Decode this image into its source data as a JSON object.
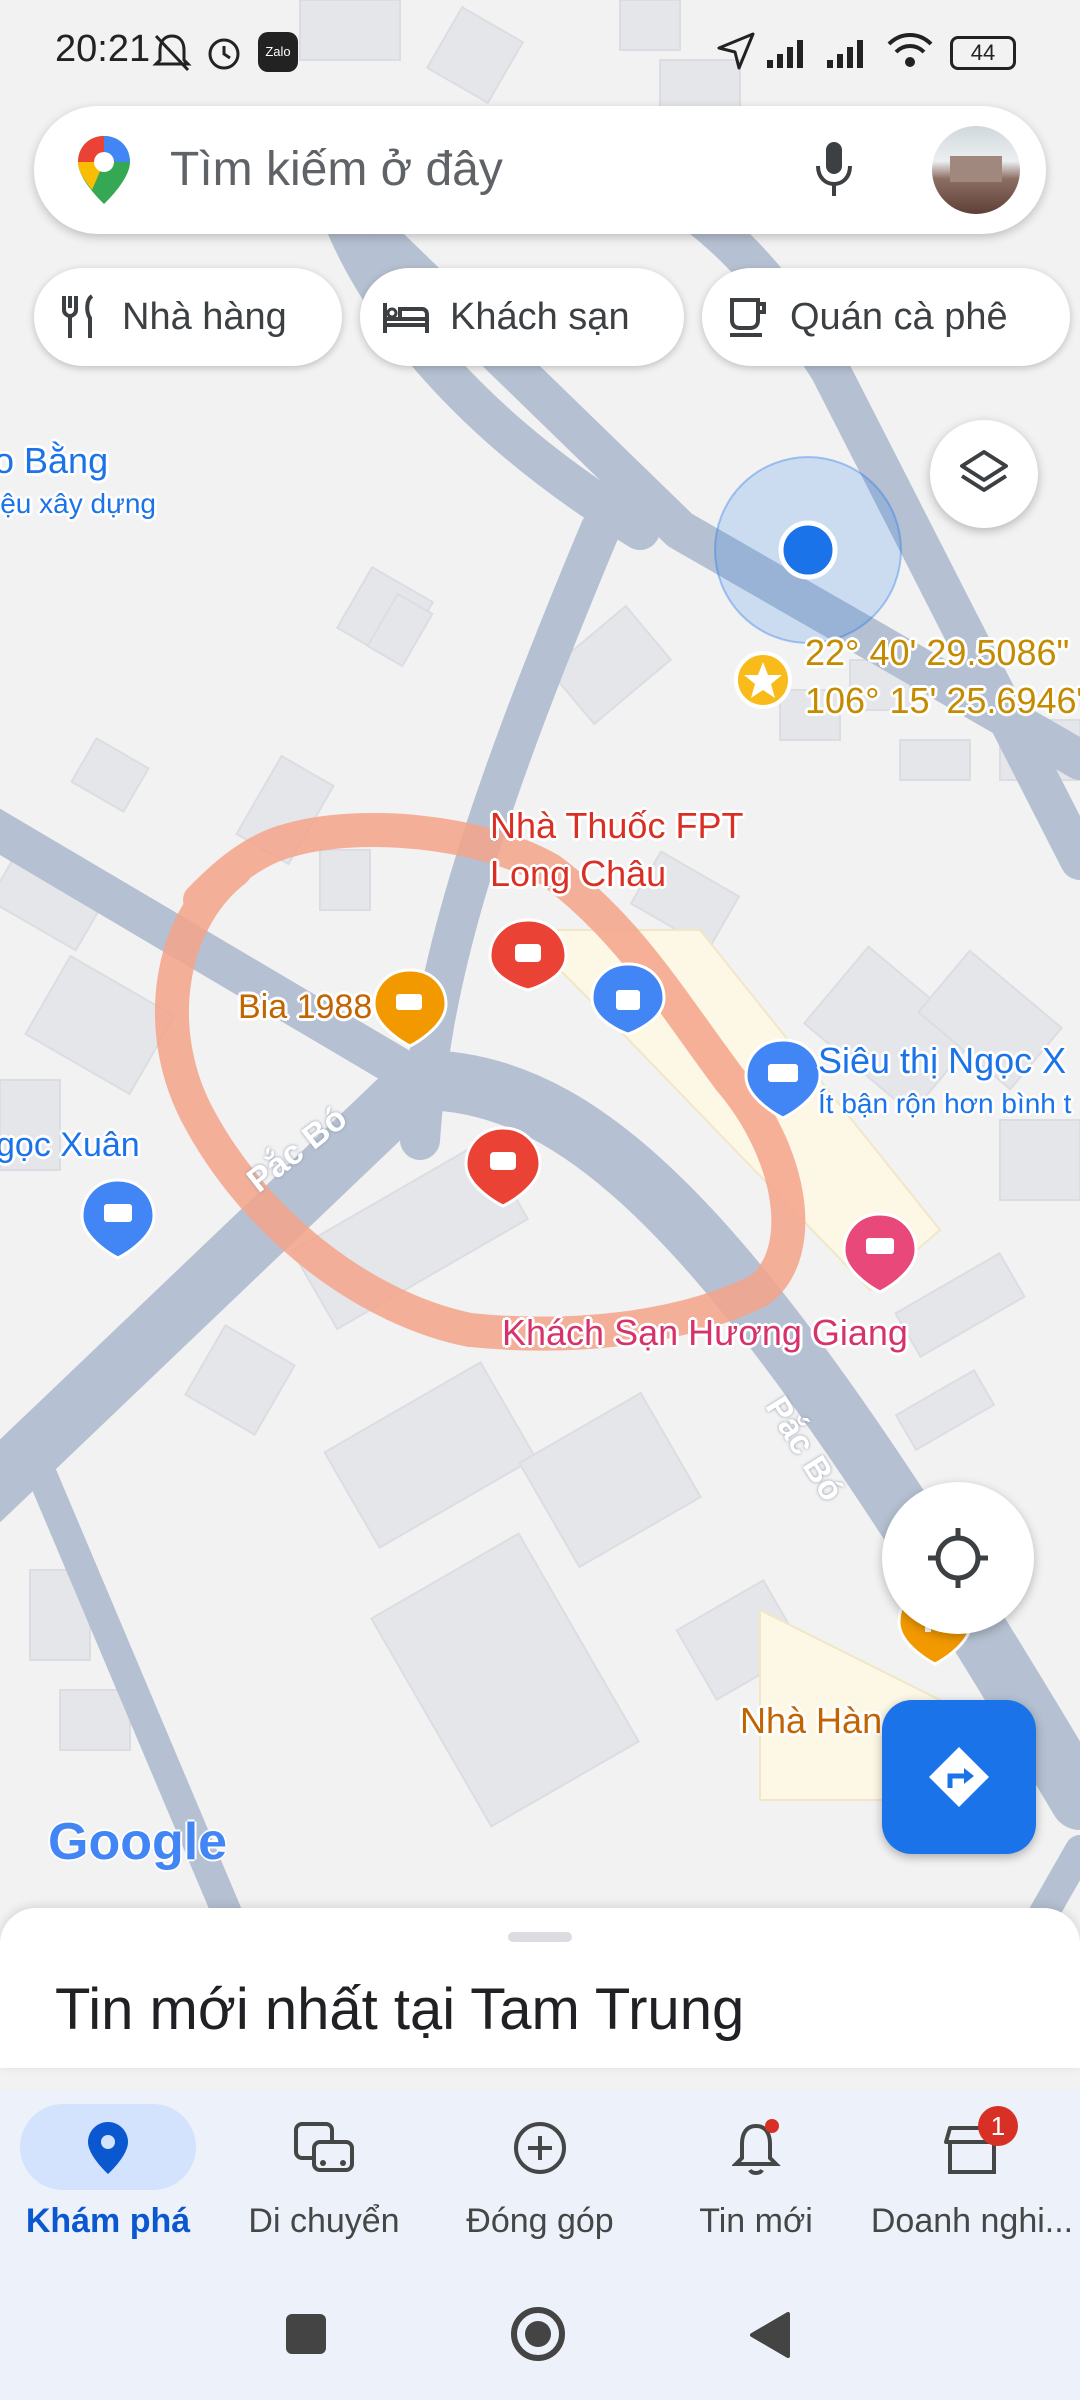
{
  "status_bar": {
    "time": "20:21",
    "left_icons": [
      "bell-off-icon",
      "alarm-icon",
      "zalo-icon"
    ],
    "zalo_label": "Zalo",
    "right_icons": [
      "location-arrow-icon",
      "signal-icon",
      "signal-icon",
      "wifi-icon",
      "battery-icon"
    ],
    "battery": "44"
  },
  "search": {
    "placeholder": "Tìm kiếm ở đây",
    "icons": [
      "maps-pin-logo-icon",
      "microphone-icon",
      "avatar"
    ]
  },
  "chips": [
    {
      "label": "Nhà hàng",
      "icon": "fork-knife-icon"
    },
    {
      "label": "Khách sạn",
      "icon": "bed-icon"
    },
    {
      "label": "Quán cà phê",
      "icon": "coffee-cup-icon"
    }
  ],
  "map": {
    "labels": {
      "place_top_left": "o Bằng",
      "place_top_left_sub": "iệu xây dựng",
      "coordinates_lat": "22° 40' 29.5086\"",
      "coordinates_lng": "106° 15' 25.6946\"",
      "pharmacy": "Nhà Thuốc FPT\nLong Châu",
      "bia": "Bia 1988",
      "sieuthi": "Siêu thị Ngọc X",
      "sieuthi_sub": "Ít bận rộn hơn bình t",
      "ngocxuan": "gọc Xuân",
      "street1": "Pắc Bó",
      "street2": "Pắc Bó",
      "hotel": "Khách Sạn Hương Giang",
      "restaurant": "Nhà Hàn"
    },
    "colors": {
      "road": "#b5c1d2",
      "background": "#f2f2f2",
      "building": "#e5e6ea",
      "annotation": "#f4a38a",
      "blue_dot": "#1a73e8",
      "pin_red": "#ea4335",
      "pin_orange": "#f29900",
      "pin_blue": "#4285f4",
      "pin_pink": "#e8497a"
    },
    "logo": "Google"
  },
  "buttons": {
    "layers": "layers-icon",
    "my_location": "crosshair-icon",
    "directions": "directions-icon"
  },
  "sheet": {
    "title": "Tin mới nhất tại Tam Trung"
  },
  "bottom_nav": [
    {
      "label": "Khám phá",
      "icon": "location-pin-icon",
      "active": true
    },
    {
      "label": "Di chuyển",
      "icon": "commute-icon"
    },
    {
      "label": "Đóng góp",
      "icon": "add-circle-icon"
    },
    {
      "label": "Tin mới",
      "icon": "bell-icon",
      "dot": true
    },
    {
      "label": "Doanh nghi...",
      "icon": "store-icon",
      "badge": "1"
    }
  ],
  "system_nav": [
    "recents-square-icon",
    "home-circle-icon",
    "back-triangle-icon"
  ]
}
